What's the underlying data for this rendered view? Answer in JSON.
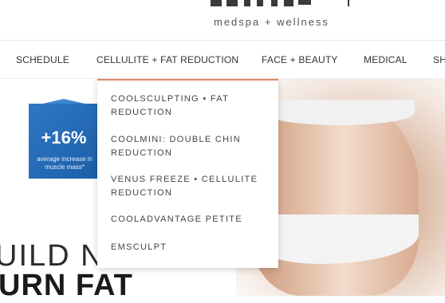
{
  "header": {
    "logo_tagline": "medspa + wellness"
  },
  "nav": {
    "items": [
      {
        "label": "SCHEDULE"
      },
      {
        "label": "CELLULITE + FAT REDUCTION"
      },
      {
        "label": "FACE + BEAUTY"
      },
      {
        "label": "MEDICAL"
      },
      {
        "label": "SH"
      }
    ]
  },
  "dropdown": {
    "items": [
      {
        "label": "COOLSCULPTING • FAT REDUCTION"
      },
      {
        "label": "COOLMINI: DOUBLE CHIN REDUCTION"
      },
      {
        "label": "VENUS FREEZE • CELLULITE REDUCTION"
      },
      {
        "label": "COOLADVANTAGE PETITE"
      },
      {
        "label": "EMSCULPT"
      }
    ],
    "accent_color": "#e0826a"
  },
  "hero": {
    "badge": {
      "value": "+16%",
      "caption": "average increase in muscle mass*",
      "color": "#2f77c4"
    },
    "headline_line1": "UILD N",
    "headline_line2": "URN FAT"
  }
}
